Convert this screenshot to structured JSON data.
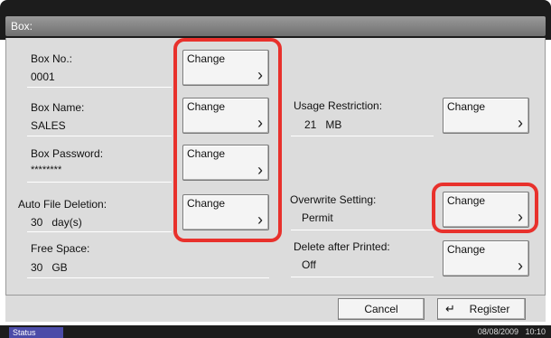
{
  "window": {
    "title": "Box:"
  },
  "fields": {
    "box_no": {
      "label": "Box No.:",
      "value": "0001",
      "button": "Change"
    },
    "box_name": {
      "label": "Box Name:",
      "value": "SALES",
      "button": "Change"
    },
    "box_password": {
      "label": "Box Password:",
      "value": "********",
      "button": "Change"
    },
    "auto_file_deletion": {
      "label": "Auto File Deletion:",
      "value": "30   day(s)",
      "button": "Change"
    },
    "free_space": {
      "label": "Free Space:",
      "value": "30   GB"
    },
    "usage_restriction": {
      "label": "Usage Restriction:",
      "value": "21   MB",
      "button": "Change"
    },
    "overwrite_setting": {
      "label": "Overwrite Setting:",
      "value": "Permit",
      "button": "Change"
    },
    "delete_after_printed": {
      "label": "Delete after Printed:",
      "value": "Off",
      "button": "Change"
    }
  },
  "footer": {
    "cancel": "Cancel",
    "register": "Register"
  },
  "statusbar": {
    "status": "Status",
    "datetime": "08/08/2009   10:10"
  },
  "colors": {
    "highlight": "#e8312c",
    "status_tab": "#4b4ba8"
  },
  "icons": {
    "chevron": "chevron-right-icon",
    "register": "return-arrow-icon"
  }
}
